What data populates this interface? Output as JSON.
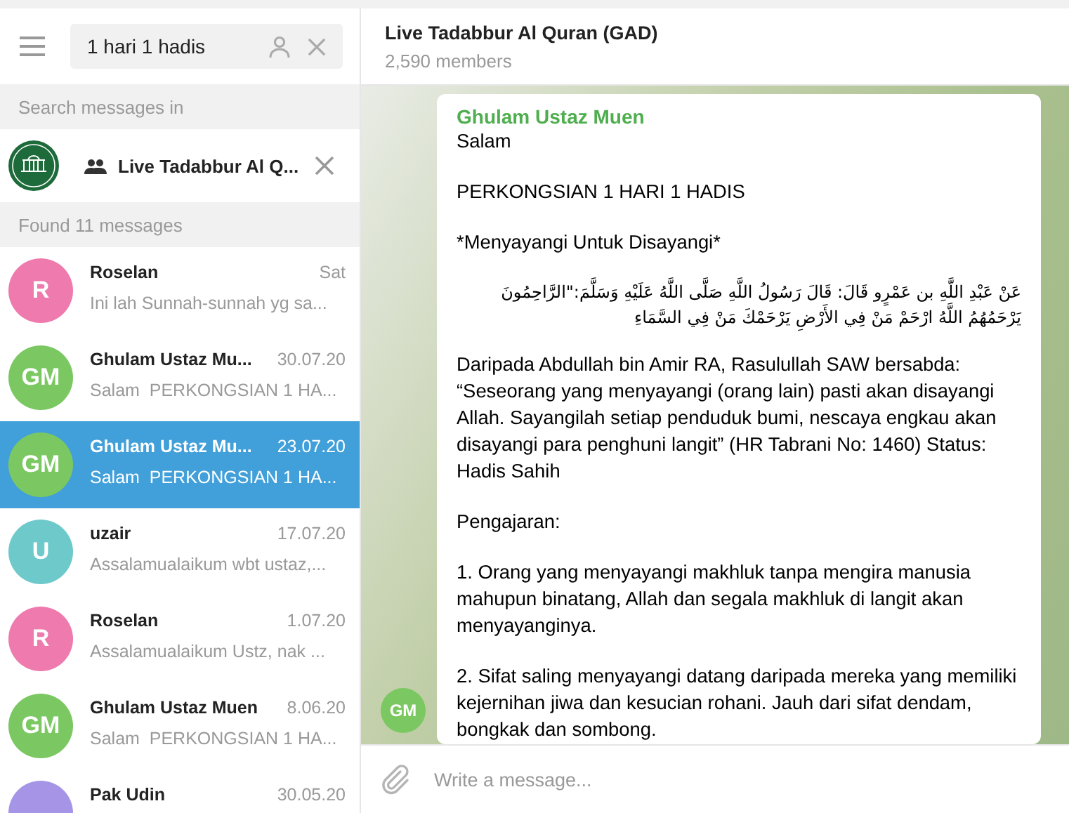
{
  "search": {
    "value": "1 hari 1 hadis"
  },
  "search_scope": {
    "label": "Search messages in",
    "chat_name": "Live Tadabbur Al Q..."
  },
  "results_header": "Found 11 messages",
  "results": [
    {
      "initials": "R",
      "color": "#ee7aae",
      "name": "Roselan",
      "date": "Sat",
      "preview": "Ini lah Sunnah-sunnah yg sa...",
      "selected": false
    },
    {
      "initials": "GM",
      "color": "#7bc862",
      "name": "Ghulam Ustaz Mu...",
      "date": "30.07.20",
      "preview": "Salam  PERKONGSIAN 1 HA...",
      "selected": false
    },
    {
      "initials": "GM",
      "color": "#7bc862",
      "name": "Ghulam Ustaz Mu...",
      "date": "23.07.20",
      "preview": "Salam  PERKONGSIAN 1 HA...",
      "selected": true
    },
    {
      "initials": "U",
      "color": "#6ec9cb",
      "name": "uzair",
      "date": "17.07.20",
      "preview": "Assalamualaikum wbt ustaz,...",
      "selected": false
    },
    {
      "initials": "R",
      "color": "#ee7aae",
      "name": "Roselan",
      "date": "1.07.20",
      "preview": "Assalamualaikum Ustz, nak ...",
      "selected": false
    },
    {
      "initials": "GM",
      "color": "#7bc862",
      "name": "Ghulam Ustaz Muen",
      "date": "8.06.20",
      "preview": "Salam  PERKONGSIAN 1 HA...",
      "selected": false
    },
    {
      "color": "#a695e7",
      "name": "Pak Udin",
      "date": "30.05.20",
      "selected": false
    }
  ],
  "chat": {
    "title": "Live Tadabbur Al Quran (GAD)",
    "subtitle": "2,590 members"
  },
  "message": {
    "author": "Ghulam Ustaz Muen",
    "avatar": {
      "initials": "GM",
      "color": "#7bc862"
    },
    "paragraphs": [
      {
        "kind": "text",
        "text": "Salam"
      },
      {
        "kind": "text",
        "text": "PERKONGSIAN 1 HARI 1 HADIS"
      },
      {
        "kind": "text",
        "text": "*Menyayangi Untuk Disayangi*"
      },
      {
        "kind": "arabic",
        "text": "عَنْ عَبْدِ اللَّهِ بن عَمْرٍو قَالَ: قَالَ رَسُولُ اللَّهِ صَلَّى اللَّهُ عَلَيْهِ وَسَلَّمَ:\"الرَّاحِمُونَ يَرْحَمُهُمُ اللَّهُ ارْحَمْ مَنْ فِي الأَرْضِ يَرْحَمْكَ مَنْ فِي السَّمَاءِ"
      },
      {
        "kind": "text",
        "text": "Daripada Abdullah bin Amir RA, Rasulullah SAW bersabda: “Seseorang yang menyayangi (orang lain) pasti akan disayangi Allah. Sayangilah setiap penduduk bumi, nescaya engkau akan disayangi para penghuni langit” (HR Tabrani No: 1460) Status: Hadis Sahih"
      },
      {
        "kind": "text",
        "text": "Pengajaran:"
      },
      {
        "kind": "text",
        "text": "1.  Orang yang menyayangi makhluk tanpa mengira manusia mahupun binatang, Allah dan segala makhluk di langit akan menyayanginya."
      },
      {
        "kind": "text",
        "text": "2.  Sifat saling menyayangi datang daripada mereka yang memiliki kejernihan jiwa dan kesucian rohani. Jauh dari sifat dendam, bongkak dan sombong."
      }
    ]
  },
  "composer": {
    "placeholder": "Write a message..."
  }
}
